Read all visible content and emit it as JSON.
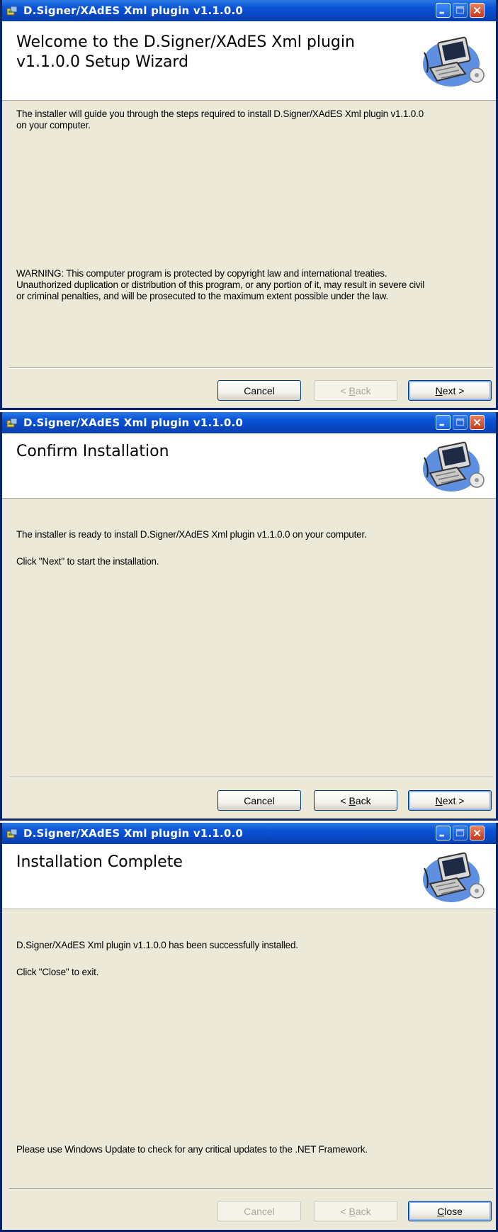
{
  "windows": [
    {
      "title": "D.Signer/XAdES Xml plugin v1.1.0.0",
      "banner_title_line1": "Welcome to the D.Signer/XAdES Xml plugin",
      "banner_title_line2": "v1.1.0.0 Setup Wizard",
      "paragraph1_line1": "The installer will guide you through the steps required to install D.Signer/XAdES Xml plugin v1.1.0.0",
      "paragraph1_line2": "on your computer.",
      "warning_line1": "WARNING: This computer program is protected by copyright law and international treaties.",
      "warning_line2": "Unauthorized duplication or distribution of this program, or any portion of it, may result in severe civil",
      "warning_line3": "or criminal penalties, and will be prosecuted to the maximum extent possible under the law.",
      "buttons": {
        "cancel": "Cancel",
        "back_prefix": "< ",
        "back_mnemonic": "B",
        "back_rest": "ack",
        "next_mnemonic": "N",
        "next_rest": "ext >"
      }
    },
    {
      "title": "D.Signer/XAdES Xml plugin v1.1.0.0",
      "banner_title": "Confirm Installation",
      "line1": "The installer is ready to install D.Signer/XAdES Xml plugin v1.1.0.0 on your computer.",
      "line2": "Click \"Next\" to start the installation.",
      "buttons": {
        "cancel": "Cancel",
        "back_prefix": "< ",
        "back_mnemonic": "B",
        "back_rest": "ack",
        "next_mnemonic": "N",
        "next_rest": "ext >"
      }
    },
    {
      "title": "D.Signer/XAdES Xml plugin v1.1.0.0",
      "banner_title": "Installation Complete",
      "line1": "D.Signer/XAdES Xml plugin v1.1.0.0 has been successfully installed.",
      "line2": "Click \"Close\" to exit.",
      "footer_note": "Please use Windows Update to check for any critical updates to the .NET Framework.",
      "buttons": {
        "cancel": "Cancel",
        "back_prefix": "< ",
        "back_mnemonic": "B",
        "back_rest": "ack",
        "close_mnemonic": "C",
        "close_rest": "lose"
      }
    }
  ],
  "colors": {
    "titlebar_blue": "#0a54d8",
    "dialog_face": "#ece9d8",
    "close_red": "#d5532e"
  }
}
